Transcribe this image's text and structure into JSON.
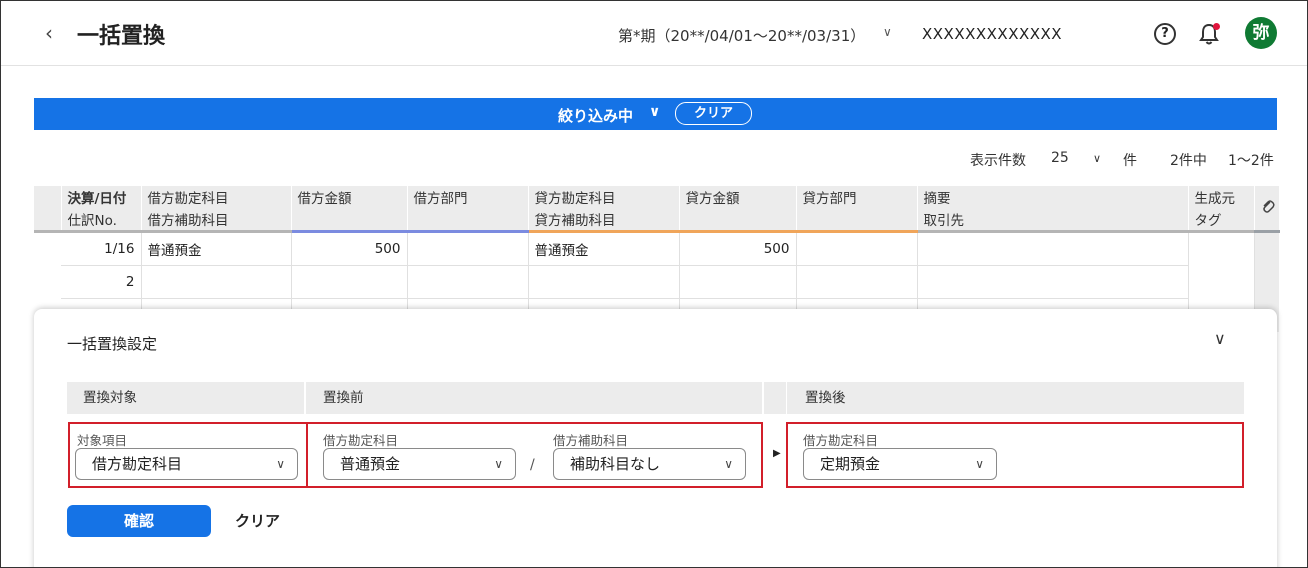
{
  "header": {
    "back_icon": "chevron-left-icon",
    "title": "一括置換",
    "period": "第*期（20**/04/01〜20**/03/31）",
    "company": "XXXXXXXXXXXXX",
    "avatar_text": "弥",
    "avatar_color": "#0f7a33",
    "notification_dot_color": "#e0143c"
  },
  "filter": {
    "label": "絞り込み中",
    "clear": "クリア",
    "bar_color": "#1573e6"
  },
  "pager": {
    "per_page_label": "表示件数",
    "per_page_value": "25",
    "unit": "件",
    "total": "2件中",
    "range": "1〜2件"
  },
  "table": {
    "columns_top": [
      "決算/日付",
      "借方勘定科目",
      "借方金額",
      "借方部門",
      "貸方勘定科目",
      "貸方金額",
      "貸方部門",
      "摘要",
      "生成元"
    ],
    "columns_sub": [
      "仕訳No.",
      "借方補助科目",
      "",
      "",
      "貸方補助科目",
      "",
      "",
      "取引先",
      "タグ"
    ],
    "attach_icon": "paperclip-icon",
    "rows": [
      {
        "date": "1/16",
        "no": "2",
        "debit_account": "普通預金",
        "debit_amount": "500",
        "credit_account": "普通預金",
        "credit_amount": "500"
      }
    ]
  },
  "panel": {
    "title": "一括置換設定",
    "target_header": "置換対象",
    "before_header": "置換前",
    "after_header": "置換後",
    "target_label": "対象項目",
    "target_value": "借方勘定科目",
    "before_account_label": "借方勘定科目",
    "before_account_value": "普通預金",
    "before_sub_label": "借方補助科目",
    "before_sub_value": "補助科目なし",
    "slash": "/",
    "after_label": "借方勘定科目",
    "after_value": "定期預金",
    "confirm": "確認",
    "clear": "クリア",
    "highlight_color": "#d21f2a"
  }
}
